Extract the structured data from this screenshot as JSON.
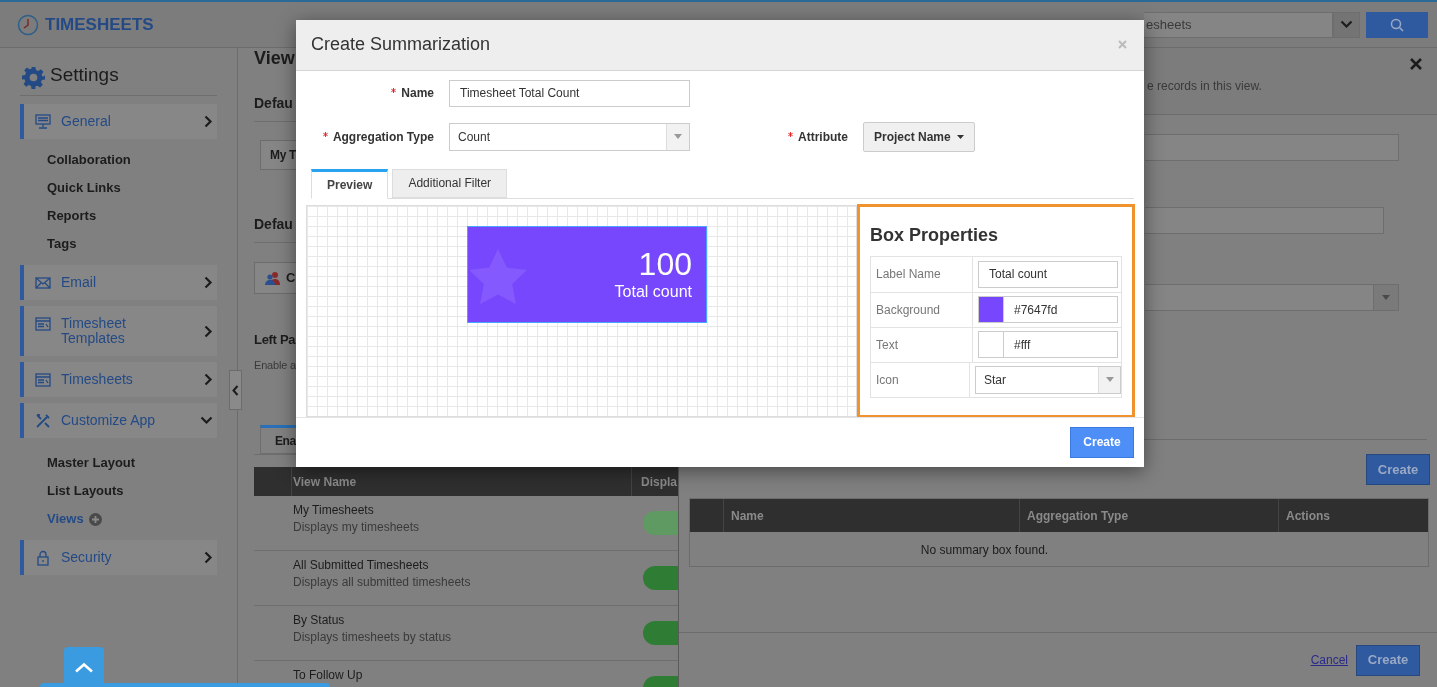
{
  "header": {
    "title": "TIMESHEETS",
    "search_placeholder": "esheets"
  },
  "sidebar": {
    "heading": "Settings",
    "items": [
      {
        "label": "General",
        "expanded": false,
        "children": [
          {
            "label": "Collaboration",
            "selected": false
          },
          {
            "label": "Quick Links",
            "selected": false
          },
          {
            "label": "Reports",
            "selected": false
          },
          {
            "label": "Tags",
            "selected": false
          }
        ]
      },
      {
        "label": "Email",
        "expanded": false
      },
      {
        "label": "Timesheet Templates",
        "expanded": false
      },
      {
        "label": "Timesheets",
        "expanded": false
      },
      {
        "label": "Customize App",
        "expanded": true,
        "children": [
          {
            "label": "Master Layout",
            "selected": false
          },
          {
            "label": "List Layouts",
            "selected": false
          },
          {
            "label": "Views",
            "selected": true
          }
        ]
      },
      {
        "label": "Security",
        "expanded": false
      }
    ]
  },
  "main": {
    "heading": "View",
    "default_view": {
      "title": "Defau",
      "button": "My T"
    },
    "default_group": {
      "title": "Defau",
      "button": "C"
    },
    "left_panel": {
      "title": "Left Pa",
      "description": "Enable a"
    },
    "tabs": [
      {
        "label": "Ena",
        "selected": true
      }
    ],
    "table": {
      "columns": [
        "View Name",
        "Displa"
      ],
      "rows": [
        {
          "name": "My Timesheets",
          "description": "Displays my timesheets",
          "on": true,
          "disabled": true
        },
        {
          "name": "All Submitted Timesheets",
          "description": "Displays all submitted timesheets",
          "on": true,
          "disabled": false
        },
        {
          "name": "By Status",
          "description": "Displays timesheets by status",
          "on": true,
          "disabled": false
        },
        {
          "name": "To Follow Up",
          "on": true,
          "disabled": false
        }
      ]
    }
  },
  "panel": {
    "note": "e records in this view.",
    "fields": [
      {
        "kind": "input"
      },
      {
        "kind": "input"
      },
      {
        "kind": "select"
      }
    ],
    "create_button": "Create",
    "table": {
      "columns": [
        "Name",
        "Aggregation Type",
        "Actions"
      ],
      "empty_message": "No summary box found."
    },
    "cancel_link": "Cancel",
    "save_button": "Create"
  },
  "modal": {
    "title": "Create Summarization",
    "fields": [
      {
        "label": "Name",
        "required": true,
        "kind": "input",
        "value": "Timesheet Total Count"
      },
      {
        "label": "Aggregation Type",
        "required": true,
        "kind": "select",
        "value": "Count"
      }
    ],
    "attribute": {
      "label": "Attribute",
      "required": true,
      "value": "Project Name"
    },
    "tabs": [
      {
        "label": "Preview",
        "selected": true
      },
      {
        "label": "Additional Filter",
        "selected": false
      }
    ],
    "preview": {
      "value": "100",
      "label": "Total count"
    },
    "box_properties": {
      "title": "Box Properties",
      "rows": [
        {
          "label": "Label Name",
          "kind": "text",
          "value": "Total count"
        },
        {
          "label": "Background",
          "kind": "color",
          "value": "#7647fd"
        },
        {
          "label": "Text",
          "kind": "color",
          "value": "#fff"
        },
        {
          "label": "Icon",
          "kind": "select",
          "value": "Star"
        }
      ]
    },
    "create_button": "Create"
  }
}
